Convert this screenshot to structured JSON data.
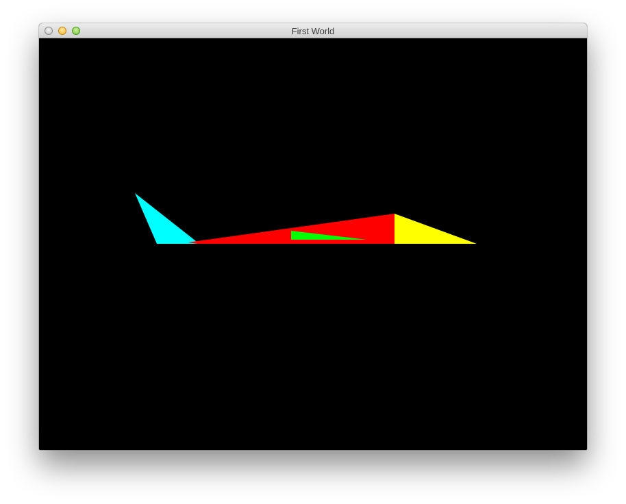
{
  "window": {
    "title": "First World",
    "controls": {
      "close": "close-button",
      "minimize": "minimize-button",
      "maximize": "maximize-button"
    }
  },
  "scene": {
    "background": "#000000",
    "shapes": [
      {
        "name": "tail-fin-cyan",
        "color": "#00ffff"
      },
      {
        "name": "fuselage-red",
        "color": "#ff0000"
      },
      {
        "name": "cockpit-green",
        "color": "#00ff00"
      },
      {
        "name": "nose-yellow",
        "color": "#ffff00"
      }
    ]
  }
}
